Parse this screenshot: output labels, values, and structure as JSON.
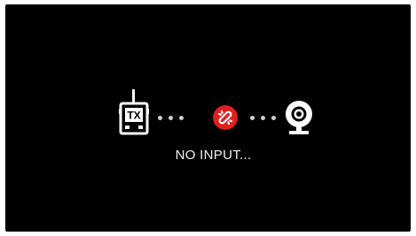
{
  "screen": {
    "background": "#000000",
    "accent_link_color": "#e02020",
    "icons": {
      "source": "tx-transmitter-icon",
      "link": "broken-link-icon",
      "destination": "webcam-icon"
    },
    "transmitter_label": "TX",
    "status_text": "NO INPUT..."
  }
}
